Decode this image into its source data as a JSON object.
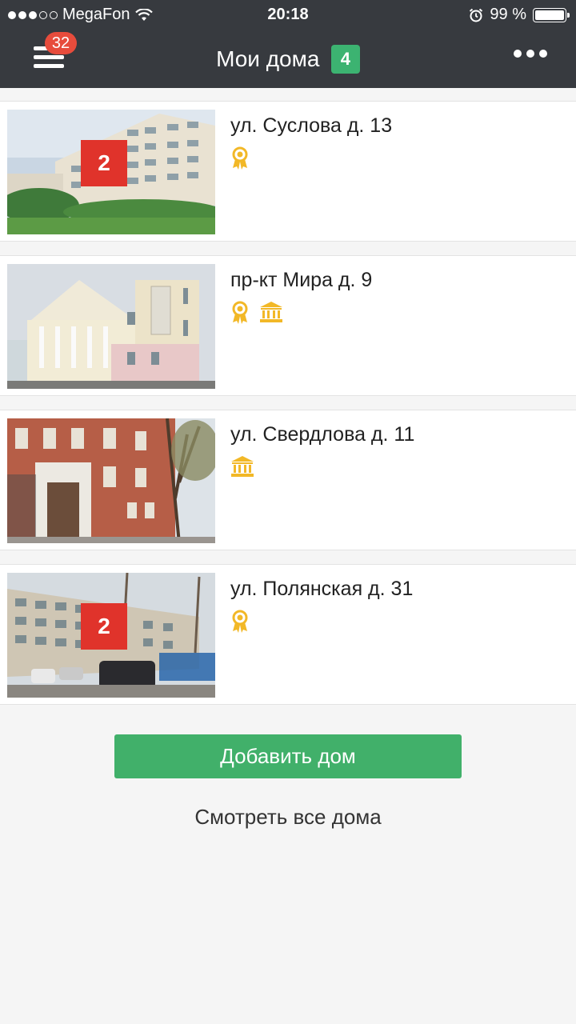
{
  "status_bar": {
    "carrier": "MegaFon",
    "time": "20:18",
    "battery": "99 %"
  },
  "header": {
    "menu_badge": "32",
    "title": "Мои дома",
    "count": "4"
  },
  "houses": [
    {
      "address": "ул. Суслова д. 13",
      "badge": "2",
      "icons": [
        "award-icon"
      ]
    },
    {
      "address": "пр-кт Мира д. 9",
      "badge": "",
      "icons": [
        "award-icon",
        "museum-icon"
      ]
    },
    {
      "address": "ул. Свердлова д. 11",
      "badge": "",
      "icons": [
        "museum-icon"
      ]
    },
    {
      "address": "ул. Полянская д. 31",
      "badge": "2",
      "icons": [
        "award-icon"
      ]
    }
  ],
  "actions": {
    "add_house": "Добавить дом",
    "view_all": "Смотреть все дома"
  },
  "colors": {
    "header_bg": "#373a3f",
    "accent_green": "#41b06a",
    "badge_red": "#e0332b",
    "icon_yellow": "#f2b827"
  }
}
